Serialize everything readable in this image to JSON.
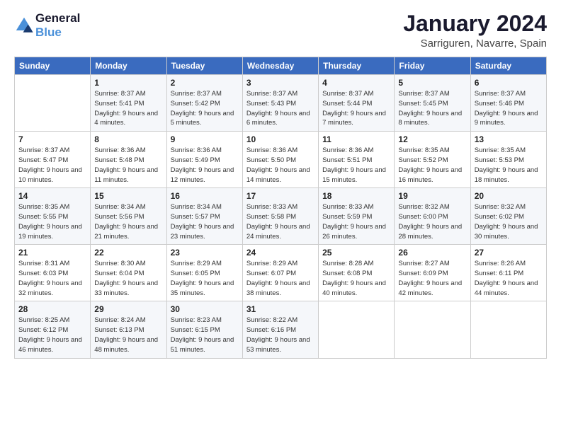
{
  "logo": {
    "line1": "General",
    "line2": "Blue"
  },
  "title": "January 2024",
  "subtitle": "Sarriguren, Navarre, Spain",
  "weekdays": [
    "Sunday",
    "Monday",
    "Tuesday",
    "Wednesday",
    "Thursday",
    "Friday",
    "Saturday"
  ],
  "weeks": [
    [
      {
        "day": "",
        "sunrise": "",
        "sunset": "",
        "daylight": ""
      },
      {
        "day": "1",
        "sunrise": "Sunrise: 8:37 AM",
        "sunset": "Sunset: 5:41 PM",
        "daylight": "Daylight: 9 hours and 4 minutes."
      },
      {
        "day": "2",
        "sunrise": "Sunrise: 8:37 AM",
        "sunset": "Sunset: 5:42 PM",
        "daylight": "Daylight: 9 hours and 5 minutes."
      },
      {
        "day": "3",
        "sunrise": "Sunrise: 8:37 AM",
        "sunset": "Sunset: 5:43 PM",
        "daylight": "Daylight: 9 hours and 6 minutes."
      },
      {
        "day": "4",
        "sunrise": "Sunrise: 8:37 AM",
        "sunset": "Sunset: 5:44 PM",
        "daylight": "Daylight: 9 hours and 7 minutes."
      },
      {
        "day": "5",
        "sunrise": "Sunrise: 8:37 AM",
        "sunset": "Sunset: 5:45 PM",
        "daylight": "Daylight: 9 hours and 8 minutes."
      },
      {
        "day": "6",
        "sunrise": "Sunrise: 8:37 AM",
        "sunset": "Sunset: 5:46 PM",
        "daylight": "Daylight: 9 hours and 9 minutes."
      }
    ],
    [
      {
        "day": "7",
        "sunrise": "Sunrise: 8:37 AM",
        "sunset": "Sunset: 5:47 PM",
        "daylight": "Daylight: 9 hours and 10 minutes."
      },
      {
        "day": "8",
        "sunrise": "Sunrise: 8:36 AM",
        "sunset": "Sunset: 5:48 PM",
        "daylight": "Daylight: 9 hours and 11 minutes."
      },
      {
        "day": "9",
        "sunrise": "Sunrise: 8:36 AM",
        "sunset": "Sunset: 5:49 PM",
        "daylight": "Daylight: 9 hours and 12 minutes."
      },
      {
        "day": "10",
        "sunrise": "Sunrise: 8:36 AM",
        "sunset": "Sunset: 5:50 PM",
        "daylight": "Daylight: 9 hours and 14 minutes."
      },
      {
        "day": "11",
        "sunrise": "Sunrise: 8:36 AM",
        "sunset": "Sunset: 5:51 PM",
        "daylight": "Daylight: 9 hours and 15 minutes."
      },
      {
        "day": "12",
        "sunrise": "Sunrise: 8:35 AM",
        "sunset": "Sunset: 5:52 PM",
        "daylight": "Daylight: 9 hours and 16 minutes."
      },
      {
        "day": "13",
        "sunrise": "Sunrise: 8:35 AM",
        "sunset": "Sunset: 5:53 PM",
        "daylight": "Daylight: 9 hours and 18 minutes."
      }
    ],
    [
      {
        "day": "14",
        "sunrise": "Sunrise: 8:35 AM",
        "sunset": "Sunset: 5:55 PM",
        "daylight": "Daylight: 9 hours and 19 minutes."
      },
      {
        "day": "15",
        "sunrise": "Sunrise: 8:34 AM",
        "sunset": "Sunset: 5:56 PM",
        "daylight": "Daylight: 9 hours and 21 minutes."
      },
      {
        "day": "16",
        "sunrise": "Sunrise: 8:34 AM",
        "sunset": "Sunset: 5:57 PM",
        "daylight": "Daylight: 9 hours and 23 minutes."
      },
      {
        "day": "17",
        "sunrise": "Sunrise: 8:33 AM",
        "sunset": "Sunset: 5:58 PM",
        "daylight": "Daylight: 9 hours and 24 minutes."
      },
      {
        "day": "18",
        "sunrise": "Sunrise: 8:33 AM",
        "sunset": "Sunset: 5:59 PM",
        "daylight": "Daylight: 9 hours and 26 minutes."
      },
      {
        "day": "19",
        "sunrise": "Sunrise: 8:32 AM",
        "sunset": "Sunset: 6:00 PM",
        "daylight": "Daylight: 9 hours and 28 minutes."
      },
      {
        "day": "20",
        "sunrise": "Sunrise: 8:32 AM",
        "sunset": "Sunset: 6:02 PM",
        "daylight": "Daylight: 9 hours and 30 minutes."
      }
    ],
    [
      {
        "day": "21",
        "sunrise": "Sunrise: 8:31 AM",
        "sunset": "Sunset: 6:03 PM",
        "daylight": "Daylight: 9 hours and 32 minutes."
      },
      {
        "day": "22",
        "sunrise": "Sunrise: 8:30 AM",
        "sunset": "Sunset: 6:04 PM",
        "daylight": "Daylight: 9 hours and 33 minutes."
      },
      {
        "day": "23",
        "sunrise": "Sunrise: 8:29 AM",
        "sunset": "Sunset: 6:05 PM",
        "daylight": "Daylight: 9 hours and 35 minutes."
      },
      {
        "day": "24",
        "sunrise": "Sunrise: 8:29 AM",
        "sunset": "Sunset: 6:07 PM",
        "daylight": "Daylight: 9 hours and 38 minutes."
      },
      {
        "day": "25",
        "sunrise": "Sunrise: 8:28 AM",
        "sunset": "Sunset: 6:08 PM",
        "daylight": "Daylight: 9 hours and 40 minutes."
      },
      {
        "day": "26",
        "sunrise": "Sunrise: 8:27 AM",
        "sunset": "Sunset: 6:09 PM",
        "daylight": "Daylight: 9 hours and 42 minutes."
      },
      {
        "day": "27",
        "sunrise": "Sunrise: 8:26 AM",
        "sunset": "Sunset: 6:11 PM",
        "daylight": "Daylight: 9 hours and 44 minutes."
      }
    ],
    [
      {
        "day": "28",
        "sunrise": "Sunrise: 8:25 AM",
        "sunset": "Sunset: 6:12 PM",
        "daylight": "Daylight: 9 hours and 46 minutes."
      },
      {
        "day": "29",
        "sunrise": "Sunrise: 8:24 AM",
        "sunset": "Sunset: 6:13 PM",
        "daylight": "Daylight: 9 hours and 48 minutes."
      },
      {
        "day": "30",
        "sunrise": "Sunrise: 8:23 AM",
        "sunset": "Sunset: 6:15 PM",
        "daylight": "Daylight: 9 hours and 51 minutes."
      },
      {
        "day": "31",
        "sunrise": "Sunrise: 8:22 AM",
        "sunset": "Sunset: 6:16 PM",
        "daylight": "Daylight: 9 hours and 53 minutes."
      },
      {
        "day": "",
        "sunrise": "",
        "sunset": "",
        "daylight": ""
      },
      {
        "day": "",
        "sunrise": "",
        "sunset": "",
        "daylight": ""
      },
      {
        "day": "",
        "sunrise": "",
        "sunset": "",
        "daylight": ""
      }
    ]
  ]
}
